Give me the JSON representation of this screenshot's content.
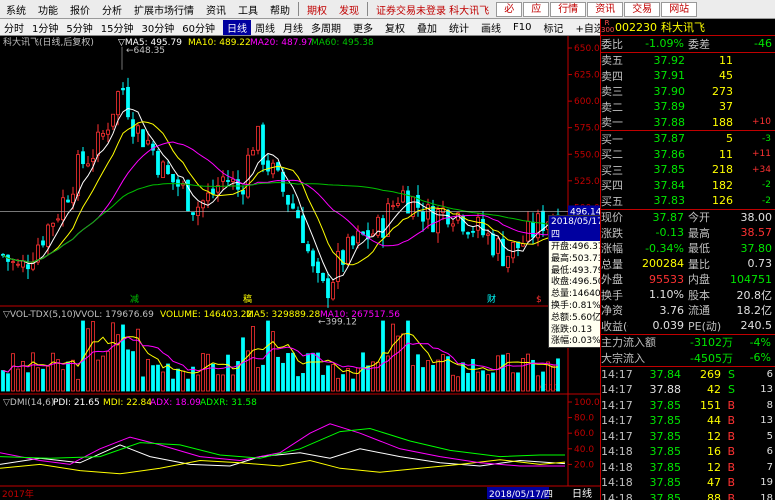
{
  "menubar": {
    "items": [
      "系统",
      "功能",
      "报价",
      "分析",
      "扩展市场行情",
      "资讯",
      "工具",
      "帮助"
    ],
    "red_items": [
      "期权",
      "发现"
    ],
    "ticker": "证券交易未登录 科大讯飞",
    "buttons": [
      "必",
      "应",
      "行情",
      "资讯",
      "交易",
      "网站"
    ]
  },
  "toolbar": {
    "items": [
      "分时",
      "1分钟",
      "5分钟",
      "15分钟",
      "30分钟",
      "60分钟",
      "日线",
      "周线",
      "月线",
      "多周期",
      "更多"
    ],
    "active": "日线",
    "right_items": [
      "复权",
      "叠加",
      "统计",
      "画线",
      "F10",
      "标记",
      "+自选",
      "返回"
    ]
  },
  "kline": {
    "label": "科大讯飞(日线,后复权)",
    "ma5": "MA5: 495.79",
    "ma10": "MA10: 489.22",
    "ma20": "MA20: 487.97",
    "ma60": "MA60: 495.38",
    "high_label": "648.35",
    "low_label": "399.12",
    "price_ticks": [
      "650.0",
      "625.0",
      "600.0",
      "575.0",
      "550.0",
      "525.0",
      "500.0",
      "475.0",
      "450.0",
      "425.0"
    ],
    "current_price": "496.14",
    "markers": [
      "减",
      "稿",
      "财",
      "$"
    ]
  },
  "volume": {
    "label": "▽VOL-TDX(5,10)",
    "vvol": "VVOL: 179676.69",
    "volume": "VOLUME: 146403.22",
    "ma5": "MA5: 329889.28",
    "ma10": "MA10: 267517.56",
    "unit": "X100"
  },
  "dmi": {
    "label": "▽DMI(14,6)",
    "pdi": "PDI: 21.65",
    "mdi": "MDI: 22.84",
    "adx": "ADX: 18.09",
    "adxr": "ADXR: 31.58",
    "ticks": [
      "100.0",
      "80.0",
      "60.0",
      "40.0",
      "20.0"
    ]
  },
  "footer": {
    "year": "2017年",
    "date": "2018/05/17/四",
    "mode": "日线"
  },
  "tooltip": {
    "date": "2018/05/17/四",
    "lines": [
      "开盘:496.37",
      "最高:503.73",
      "最低:493.79",
      "收盘:496.50",
      "总量:146403",
      "换手:0.81%",
      "总额:5.60亿",
      "涨跌:0.13",
      "涨幅:0.03%"
    ]
  },
  "quote": {
    "r_badge": "R 300",
    "code": "002230",
    "name": "科大讯飞",
    "weibi_label": "委比",
    "weibi": "-1.09%",
    "weicha_label": "委差",
    "weicha": "-46",
    "sell": [
      {
        "label": "卖五",
        "price": "37.92",
        "vol": "11",
        "chg": ""
      },
      {
        "label": "卖四",
        "price": "37.91",
        "vol": "45",
        "chg": ""
      },
      {
        "label": "卖三",
        "price": "37.90",
        "vol": "273",
        "chg": ""
      },
      {
        "label": "卖二",
        "price": "37.89",
        "vol": "37",
        "chg": ""
      },
      {
        "label": "卖一",
        "price": "37.88",
        "vol": "188",
        "chg": "+10"
      }
    ],
    "buy": [
      {
        "label": "买一",
        "price": "37.87",
        "vol": "5",
        "chg": "-3"
      },
      {
        "label": "买二",
        "price": "37.86",
        "vol": "11",
        "chg": "+11"
      },
      {
        "label": "买三",
        "price": "37.85",
        "vol": "218",
        "chg": "+34"
      },
      {
        "label": "买四",
        "price": "37.84",
        "vol": "182",
        "chg": "-2"
      },
      {
        "label": "买五",
        "price": "37.83",
        "vol": "126",
        "chg": "-2"
      }
    ],
    "stats": [
      {
        "l1": "现价",
        "v1": "37.87",
        "l2": "今开",
        "v2": "38.00"
      },
      {
        "l1": "涨跌",
        "v1": "-0.13",
        "l2": "最高",
        "v2": "38.57"
      },
      {
        "l1": "涨幅",
        "v1": "-0.34%",
        "l2": "最低",
        "v2": "37.80"
      },
      {
        "l1": "总量",
        "v1": "200284",
        "l2": "量比",
        "v2": "0.73"
      },
      {
        "l1": "外盘",
        "v1": "95533",
        "l2": "内盘",
        "v2": "104751"
      },
      {
        "l1": "换手",
        "v1": "1.10%",
        "l2": "股本",
        "v2": "20.8亿"
      },
      {
        "l1": "净资",
        "v1": "3.76",
        "l2": "流通",
        "v2": "18.2亿"
      },
      {
        "l1": "收益(一)",
        "v1": "0.039",
        "l2": "PE(动)",
        "v2": "240.5"
      }
    ],
    "flows": [
      {
        "label": "主力流入额",
        "value": "-3102万",
        "pct": "-4%"
      },
      {
        "label": "大宗流入",
        "value": "-4505万",
        "pct": "-6%"
      }
    ],
    "trades": [
      {
        "time": "14:17",
        "price": "37.84",
        "vol": "269",
        "flag": "S",
        "n": "6"
      },
      {
        "time": "14:17",
        "price": "37.88",
        "vol": "42",
        "flag": "S",
        "n": "13"
      },
      {
        "time": "14:17",
        "price": "37.85",
        "vol": "151",
        "flag": "B",
        "n": "8"
      },
      {
        "time": "14:17",
        "price": "37.85",
        "vol": "44",
        "flag": "B",
        "n": "13"
      },
      {
        "time": "14:17",
        "price": "37.85",
        "vol": "12",
        "flag": "B",
        "n": "5"
      },
      {
        "time": "14:18",
        "price": "37.85",
        "vol": "16",
        "flag": "B",
        "n": "6"
      },
      {
        "time": "14:18",
        "price": "37.85",
        "vol": "12",
        "flag": "B",
        "n": "7"
      },
      {
        "time": "14:18",
        "price": "37.85",
        "vol": "47",
        "flag": "B",
        "n": "19"
      },
      {
        "time": "14:18",
        "price": "37.85",
        "vol": "88",
        "flag": "B",
        "n": "18"
      },
      {
        "time": "14:18",
        "price": "37.87",
        "vol": "33",
        "flag": "B",
        "n": "12"
      }
    ]
  }
}
